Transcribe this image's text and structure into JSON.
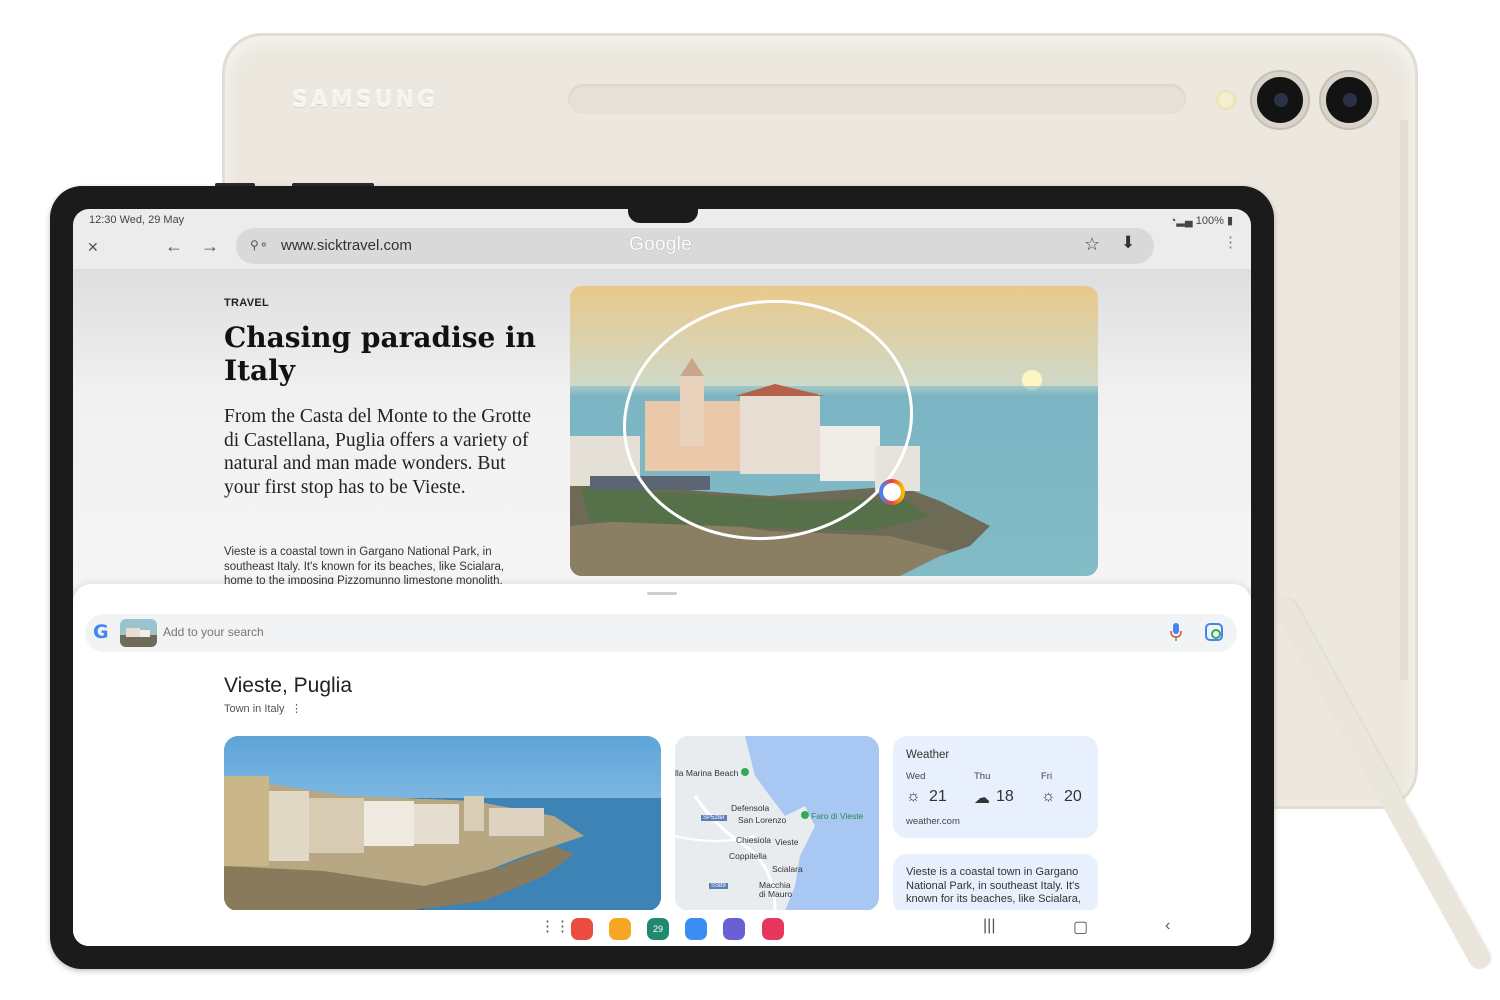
{
  "device": {
    "brand_text": "SAMSUNG",
    "finish_color": "#ece8df"
  },
  "status_bar": {
    "time_date": "12:30  Wed, 29 May",
    "battery": "100%"
  },
  "browser": {
    "url": "www.sicktravel.com",
    "overlay_wordmark": "Google",
    "icons": [
      "close-icon",
      "back-icon",
      "forward-icon",
      "site-settings-icon",
      "bookmark-star-icon",
      "download-icon",
      "more-menu-icon"
    ]
  },
  "article": {
    "kicker": "TRAVEL",
    "headline": "Chasing paradise in Italy",
    "lede": "From the Casta del Monte to the Grotte di Castellana, Puglia offers a variety of natural and man made wonders. But your first stop has to be Vieste.",
    "body": "Vieste is a coastal town in Gargano National Park, in southeast Italy. It's known for its beaches, like Scialara, home to the imposing Pizzomunno limestone monolith."
  },
  "search_sheet": {
    "placeholder": "Add to your search",
    "result_title": "Vieste, Puglia",
    "result_subtitle": "Town in Italy",
    "weather": {
      "title": "Weather",
      "days": [
        {
          "day": "Wed",
          "temp": "21",
          "icon": "sun-icon"
        },
        {
          "day": "Thu",
          "temp": "18",
          "icon": "partly-cloudy-icon"
        },
        {
          "day": "Fri",
          "temp": "20",
          "icon": "sun-icon"
        }
      ],
      "source": "weather.com"
    },
    "info": "Vieste is a coastal town in Gargano National Park, in southeast Italy. It's known for its beaches, like Scialara,",
    "map_labels": [
      "lla Marina Beach",
      "Defensola",
      "San Lorenzo",
      "Faro di Vieste",
      "Chiesiola",
      "Vieste",
      "Coppitella",
      "Scialara",
      "Macchia",
      "di Mauro",
      "SP52ter",
      "SS89"
    ]
  },
  "dock": {
    "calendar_date": "29",
    "apps": [
      {
        "name": "notes-app",
        "color": "#ea4d3f"
      },
      {
        "name": "folder-app",
        "color": "#f6a623"
      },
      {
        "name": "calendar-app",
        "color": "#1f8a70"
      },
      {
        "name": "messages-app",
        "color": "#3c8cf5"
      },
      {
        "name": "browser-app",
        "color": "#6b5fd6"
      },
      {
        "name": "camera-app",
        "color": "#e8365d"
      }
    ]
  }
}
